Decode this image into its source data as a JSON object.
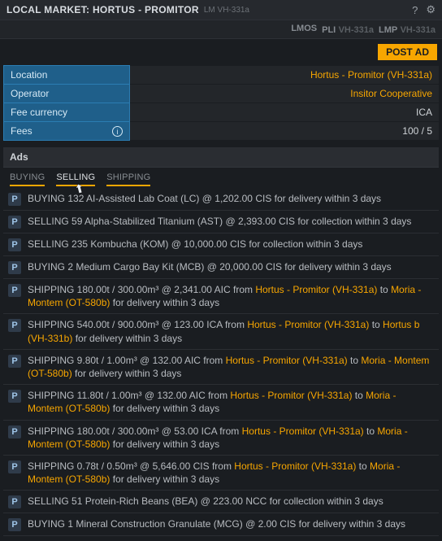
{
  "titlebar": {
    "title": "LOCAL MARKET: HORTUS - PROMITOR",
    "subtitle": "LM VH-331a"
  },
  "commands": {
    "lmos": "LMOS",
    "pli": "PLI",
    "pli_arg": "VH-331a",
    "lmp": "LMP",
    "lmp_arg": "VH-331a"
  },
  "postad": "POST AD",
  "info": {
    "location_k": "Location",
    "location_v": "Hortus - Promitor (VH-331a)",
    "operator_k": "Operator",
    "operator_v": "Insitor Cooperative",
    "feecur_k": "Fee currency",
    "feecur_v": "ICA",
    "fees_k": "Fees",
    "fees_v": "100 / 5"
  },
  "ads_header": "Ads",
  "tabs": {
    "buying": "BUYING",
    "selling": "SELLING",
    "shipping": "SHIPPING"
  },
  "badge": "P",
  "ads": [
    {
      "kind": "simple",
      "text": "BUYING 132 AI-Assisted Lab Coat (LC) @ 1,202.00 CIS for delivery within 3 days"
    },
    {
      "kind": "simple",
      "text": "SELLING 59 Alpha-Stabilized Titanium (AST) @ 2,393.00 CIS for collection within 3 days"
    },
    {
      "kind": "simple",
      "text": "SELLING 235 Kombucha (KOM) @ 10,000.00 CIS for collection within 3 days"
    },
    {
      "kind": "simple",
      "text": "BUYING 2 Medium Cargo Bay Kit (MCB) @ 20,000.00 CIS for delivery within 3 days"
    },
    {
      "kind": "ship",
      "pre": "SHIPPING 180.00t / 300.00m³ @ 2,341.00 AIC from ",
      "from": "Hortus - Promitor (VH-331a)",
      "mid": " to ",
      "to": "Moria - Montem (OT-580b)",
      "post": " for delivery within 3 days"
    },
    {
      "kind": "ship",
      "pre": "SHIPPING 540.00t / 900.00m³ @ 123.00 ICA from ",
      "from": "Hortus - Promitor (VH-331a)",
      "mid": " to ",
      "to": "Hortus b (VH-331b)",
      "post": " for delivery within 3 days"
    },
    {
      "kind": "ship",
      "pre": "SHIPPING 9.80t / 1.00m³ @ 132.00 AIC from ",
      "from": "Hortus - Promitor (VH-331a)",
      "mid": " to ",
      "to": "Moria - Montem (OT-580b)",
      "post": " for delivery within 3 days"
    },
    {
      "kind": "ship",
      "pre": "SHIPPING 11.80t / 1.00m³ @ 132.00 AIC from ",
      "from": "Hortus - Promitor (VH-331a)",
      "mid": " to ",
      "to": "Moria - Montem (OT-580b)",
      "post": " for delivery within 3 days"
    },
    {
      "kind": "ship",
      "pre": "SHIPPING 180.00t / 300.00m³ @ 53.00 ICA from ",
      "from": "Hortus - Promitor (VH-331a)",
      "mid": " to ",
      "to": "Moria - Montem (OT-580b)",
      "post": " for delivery within 3 days"
    },
    {
      "kind": "ship",
      "pre": "SHIPPING 0.78t / 0.50m³ @ 5,646.00 CIS from ",
      "from": "Hortus - Promitor (VH-331a)",
      "mid": " to ",
      "to": "Moria - Montem (OT-580b)",
      "post": " for delivery within 3 days"
    },
    {
      "kind": "simple",
      "text": "SELLING 51 Protein-Rich Beans (BEA) @ 223.00 NCC for collection within 3 days"
    },
    {
      "kind": "simple",
      "text": "BUYING 1 Mineral Construction Granulate (MCG) @ 2.00 CIS for delivery within 3 days"
    }
  ]
}
